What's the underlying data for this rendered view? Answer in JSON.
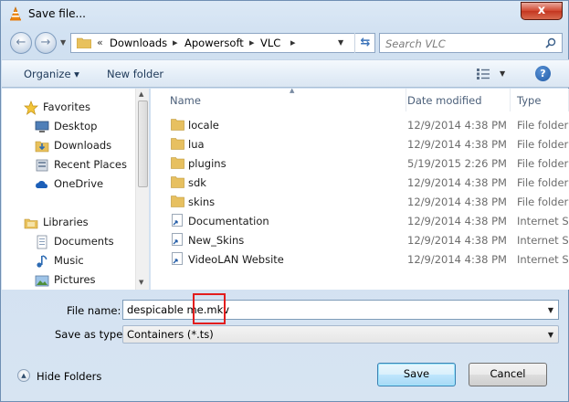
{
  "window": {
    "title": "Save file...",
    "close": "x"
  },
  "nav": {
    "back": "←",
    "forward": "→"
  },
  "address": {
    "prefix": "«",
    "crumbs": [
      "Downloads",
      "Apowersoft",
      "VLC"
    ],
    "separator": "▸"
  },
  "search": {
    "placeholder": "Search VLC"
  },
  "toolbar": {
    "organize": "Organize ▾",
    "new_folder": "New folder",
    "help": "?"
  },
  "sidebar": {
    "items": [
      {
        "label": "Favorites",
        "icon": "star-icon"
      },
      {
        "label": "Desktop",
        "icon": "desktop-icon"
      },
      {
        "label": "Downloads",
        "icon": "downloads-icon"
      },
      {
        "label": "Recent Places",
        "icon": "recent-places-icon"
      },
      {
        "label": "OneDrive",
        "icon": "cloud-icon"
      },
      {
        "label": "Libraries",
        "icon": "libraries-icon"
      },
      {
        "label": "Documents",
        "icon": "documents-icon"
      },
      {
        "label": "Music",
        "icon": "music-icon"
      },
      {
        "label": "Pictures",
        "icon": "pictures-icon"
      }
    ]
  },
  "files": {
    "columns": {
      "name": "Name",
      "date": "Date modified",
      "type": "Type"
    },
    "rows": [
      {
        "name": "locale",
        "date": "12/9/2014 4:38 PM",
        "type": "File folder",
        "icon": "folder-icon"
      },
      {
        "name": "lua",
        "date": "12/9/2014 4:38 PM",
        "type": "File folder",
        "icon": "folder-icon"
      },
      {
        "name": "plugins",
        "date": "5/19/2015 2:26 PM",
        "type": "File folder",
        "icon": "folder-icon"
      },
      {
        "name": "sdk",
        "date": "12/9/2014 4:38 PM",
        "type": "File folder",
        "icon": "folder-icon"
      },
      {
        "name": "skins",
        "date": "12/9/2014 4:38 PM",
        "type": "File folder",
        "icon": "folder-icon"
      },
      {
        "name": "Documentation",
        "date": "12/9/2014 4:38 PM",
        "type": "Internet Sh",
        "icon": "shortcut-icon"
      },
      {
        "name": "New_Skins",
        "date": "12/9/2014 4:38 PM",
        "type": "Internet Sh",
        "icon": "shortcut-icon"
      },
      {
        "name": "VideoLAN Website",
        "date": "12/9/2014 4:38 PM",
        "type": "Internet Sh",
        "icon": "shortcut-icon"
      }
    ]
  },
  "form": {
    "filename_label": "File name:",
    "filename_value": "despicable me.mkv",
    "savetype_label": "Save as type:",
    "savetype_value": "Containers (*.ts)"
  },
  "footer": {
    "hide_folders": "Hide Folders",
    "save": "Save",
    "cancel": "Cancel"
  },
  "colors": {
    "highlight": "#e21d1d",
    "accent": "#3c7fb1"
  }
}
